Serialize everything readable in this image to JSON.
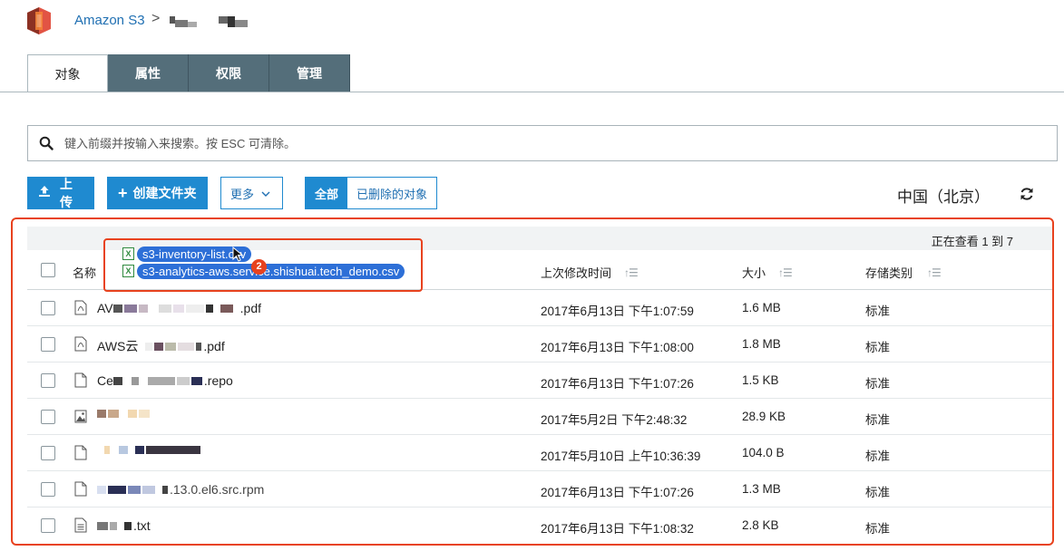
{
  "breadcrumb": {
    "service": "Amazon S3",
    "separator": ">"
  },
  "tabs": [
    {
      "label": "对象",
      "active": true
    },
    {
      "label": "属性",
      "active": false
    },
    {
      "label": "权限",
      "active": false
    },
    {
      "label": "管理",
      "active": false
    }
  ],
  "search": {
    "placeholder": "键入前缀并按输入来搜索。按 ESC 可清除。",
    "value": ""
  },
  "toolbar": {
    "upload_label": "上传",
    "create_folder_label": "创建文件夹",
    "more_label": "更多",
    "filter_all_label": "全部",
    "filter_deleted_label": "已删除的对象",
    "region": "中国（北京）"
  },
  "pager": {
    "text": "正在查看 1 到 7"
  },
  "columns": {
    "name": "名称",
    "last_modified": "上次修改时间",
    "size": "大小",
    "storage_class": "存储类别"
  },
  "drag": {
    "file1": "s3-inventory-list.csv",
    "file2": "s3-analytics-aws.service.shishuai.tech_demo.csv",
    "count": "2"
  },
  "rows": [
    {
      "name_prefix": "AV",
      "name_suffix": ".pdf",
      "icon": "pdf-file-icon",
      "modified": "2017年6月13日 下午1:07:59",
      "size": "1.6 MB",
      "storage": "标准"
    },
    {
      "name_prefix": "AWS云",
      "name_suffix": ".pdf",
      "icon": "pdf-file-icon",
      "modified": "2017年6月13日 下午1:08:00",
      "size": "1.8 MB",
      "storage": "标准"
    },
    {
      "name_prefix": "Ce",
      "name_suffix": ".repo",
      "icon": "file-icon",
      "modified": "2017年6月13日 下午1:07:26",
      "size": "1.5 KB",
      "storage": "标准"
    },
    {
      "name_prefix": "",
      "name_suffix": "",
      "icon": "image-file-icon",
      "modified": "2017年5月2日 下午2:48:32",
      "size": "28.9 KB",
      "storage": "标准"
    },
    {
      "name_prefix": "",
      "name_suffix": "",
      "icon": "file-icon",
      "modified": "2017年5月10日 上午10:36:39",
      "size": "104.0 B",
      "storage": "标准"
    },
    {
      "name_prefix": "",
      "name_suffix": ".13.0.el6.src.rpm",
      "icon": "file-icon",
      "modified": "2017年6月13日 下午1:07:26",
      "size": "1.3 MB",
      "storage": "标准"
    },
    {
      "name_prefix": "",
      "name_suffix": ".txt",
      "icon": "text-file-icon",
      "modified": "2017年6月13日 下午1:08:32",
      "size": "2.8 KB",
      "storage": "标准"
    }
  ],
  "colors": {
    "accent": "#1f8ad0",
    "tab_bg": "#546e7a",
    "highlight_border": "#e8421e",
    "logo": "#e25444"
  }
}
